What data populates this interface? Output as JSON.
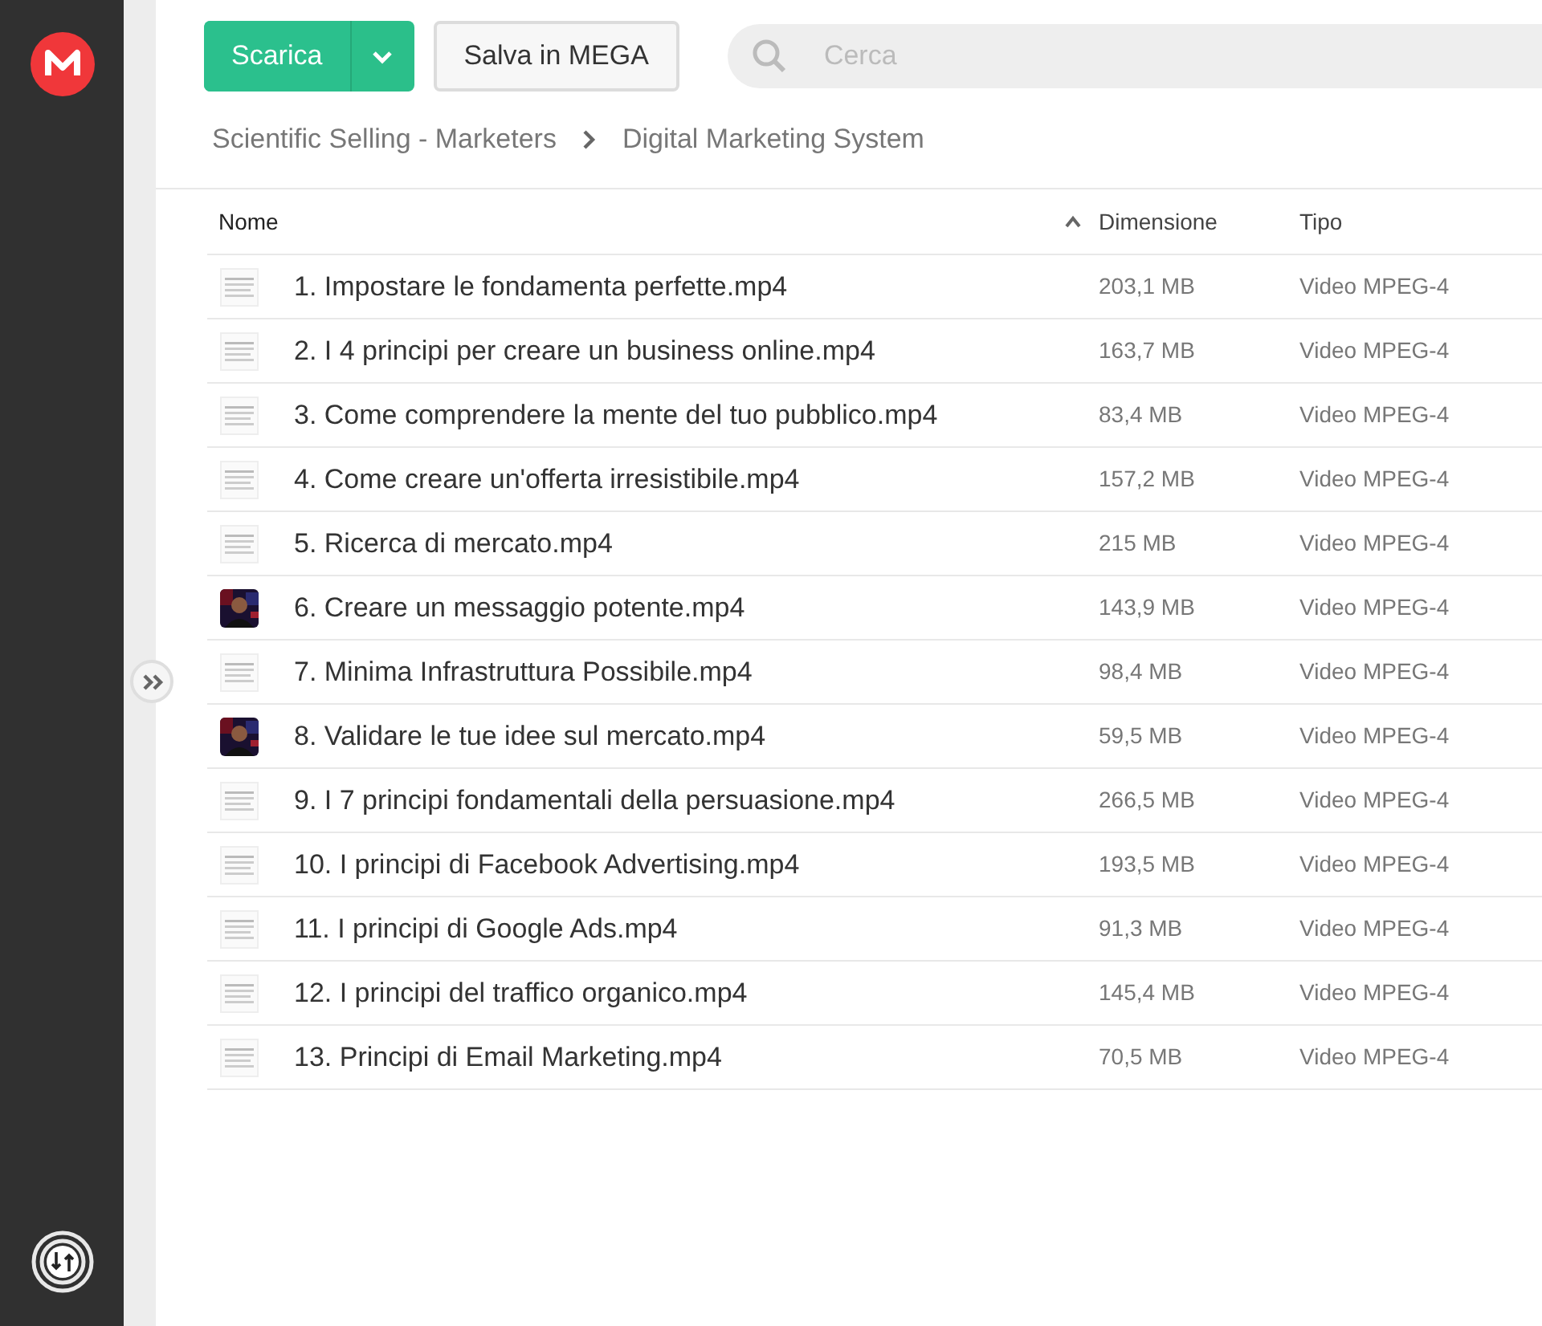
{
  "toolbar": {
    "download_button": "Scarica",
    "save_button": "Salva in MEGA",
    "search": {
      "placeholder": "Cerca"
    }
  },
  "breadcrumb": [
    "Scientific Selling - Marketers",
    "Digital Marketing System"
  ],
  "table": {
    "columns": [
      {
        "label": "Nome",
        "sorted": true
      },
      {
        "label": "Dimensione",
        "sorted": false
      },
      {
        "label": "Tipo",
        "sorted": false
      }
    ],
    "rows": [
      {
        "name": "1. Impostare le fondamenta perfette.mp4",
        "size": "203,1 MB",
        "type": "Video MPEG-4",
        "kind": "document"
      },
      {
        "name": "2. I 4 principi per creare un business online.mp4",
        "size": "163,7 MB",
        "type": "Video MPEG-4",
        "kind": "document"
      },
      {
        "name": "3. Come comprendere la mente del tuo pubblico.mp4",
        "size": "83,4 MB",
        "type": "Video MPEG-4",
        "kind": "document"
      },
      {
        "name": "4. Come creare un'offerta irresistibile.mp4",
        "size": "157,2 MB",
        "type": "Video MPEG-4",
        "kind": "document"
      },
      {
        "name": "5. Ricerca di mercato.mp4",
        "size": "215 MB",
        "type": "Video MPEG-4",
        "kind": "document"
      },
      {
        "name": "6. Creare un messaggio potente.mp4",
        "size": "143,9 MB",
        "type": "Video MPEG-4",
        "kind": "picture"
      },
      {
        "name": "7. Minima Infrastruttura Possibile.mp4",
        "size": "98,4 MB",
        "type": "Video MPEG-4",
        "kind": "document"
      },
      {
        "name": "8. Validare le tue idee sul mercato.mp4",
        "size": "59,5 MB",
        "type": "Video MPEG-4",
        "kind": "picture"
      },
      {
        "name": "9. I 7 principi fondamentali della persuasione.mp4",
        "size": "266,5 MB",
        "type": "Video MPEG-4",
        "kind": "document"
      },
      {
        "name": "10. I principi di Facebook Advertising.mp4",
        "size": "193,5 MB",
        "type": "Video MPEG-4",
        "kind": "document"
      },
      {
        "name": "11. I principi di Google Ads.mp4",
        "size": "91,3 MB",
        "type": "Video MPEG-4",
        "kind": "document"
      },
      {
        "name": "12. I principi del traffico organico.mp4",
        "size": "145,4 MB",
        "type": "Video MPEG-4",
        "kind": "document"
      },
      {
        "name": "13. Principi di Email Marketing.mp4",
        "size": "70,5 MB",
        "type": "Video MPEG-4",
        "kind": "document"
      }
    ]
  }
}
